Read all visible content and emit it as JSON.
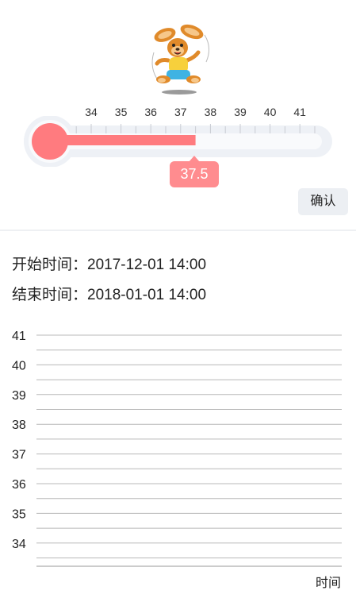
{
  "thermometer": {
    "scale_labels": [
      "34",
      "35",
      "36",
      "37",
      "38",
      "39",
      "40",
      "41"
    ],
    "scale_min": 33.5,
    "scale_max": 41.5,
    "current_value": 37.5,
    "current_value_label": "37.5",
    "fill_color": "#ff7b7f",
    "track_color": "#f4f6fa"
  },
  "confirm_button": {
    "label": "确认"
  },
  "time_info": {
    "start_label": "开始时间：",
    "start_value": "2017-12-01 14:00",
    "end_label": "结束时间：",
    "end_value": "2018-01-01 14:00"
  },
  "chart_data": {
    "type": "line",
    "title": "",
    "xlabel": "时间",
    "ylabel": "",
    "y_ticks": [
      41,
      40,
      39,
      38,
      37,
      36,
      35,
      34
    ],
    "ylim": [
      33.5,
      41
    ],
    "grid": true,
    "series": []
  }
}
